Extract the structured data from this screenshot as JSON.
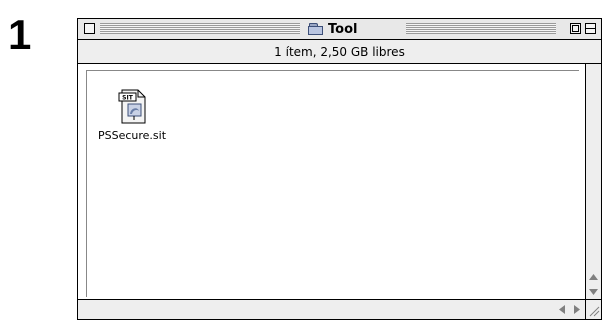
{
  "step": {
    "number": "1"
  },
  "window": {
    "title": "Tool",
    "info": "1 ítem, 2,50 GB libres"
  },
  "files": [
    {
      "name": "PSSecure.sit",
      "badge": "SIT"
    }
  ],
  "icons": {
    "close": "close-box-icon",
    "zoom": "zoom-box-icon",
    "collapse": "collapse-box-icon",
    "folder": "folder-icon",
    "file": "stuffit-archive-icon"
  }
}
